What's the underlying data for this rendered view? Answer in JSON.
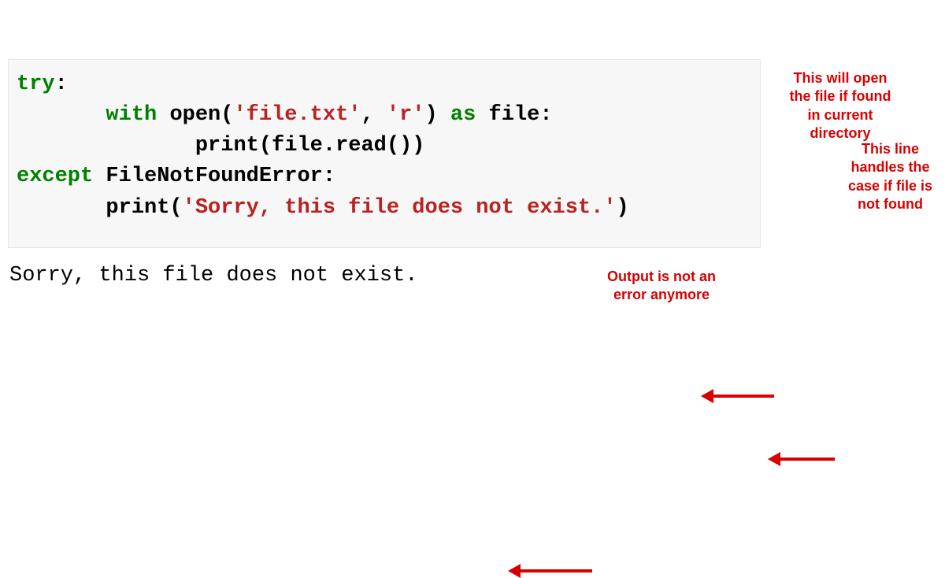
{
  "code": {
    "line1": {
      "try": "try",
      "colon": ":"
    },
    "line2": {
      "indent": "       ",
      "with": "with",
      "sp1": " ",
      "open": "open(",
      "str1": "'file.txt'",
      "comma": ", ",
      "str2": "'r'",
      "close": ")",
      "sp2": " ",
      "as": "as",
      "sp3": " ",
      "file": "file:"
    },
    "line3": {
      "indent": "              ",
      "print": "print(file.read())"
    },
    "line4": {
      "except": "except",
      "sp": " ",
      "err": "FileNotFoundError:"
    },
    "line5": {
      "indent": "       ",
      "printcall": "print(",
      "msg": "'Sorry, this file does not exist.'",
      "close": ")"
    }
  },
  "output": "Sorry, this file does not exist.",
  "annotations": {
    "a1": "This will open\nthe file if found\nin current\ndirectory",
    "a2": "This line\nhandles the\ncase if file is\nnot found",
    "a3": "Output is not an\nerror anymore"
  }
}
